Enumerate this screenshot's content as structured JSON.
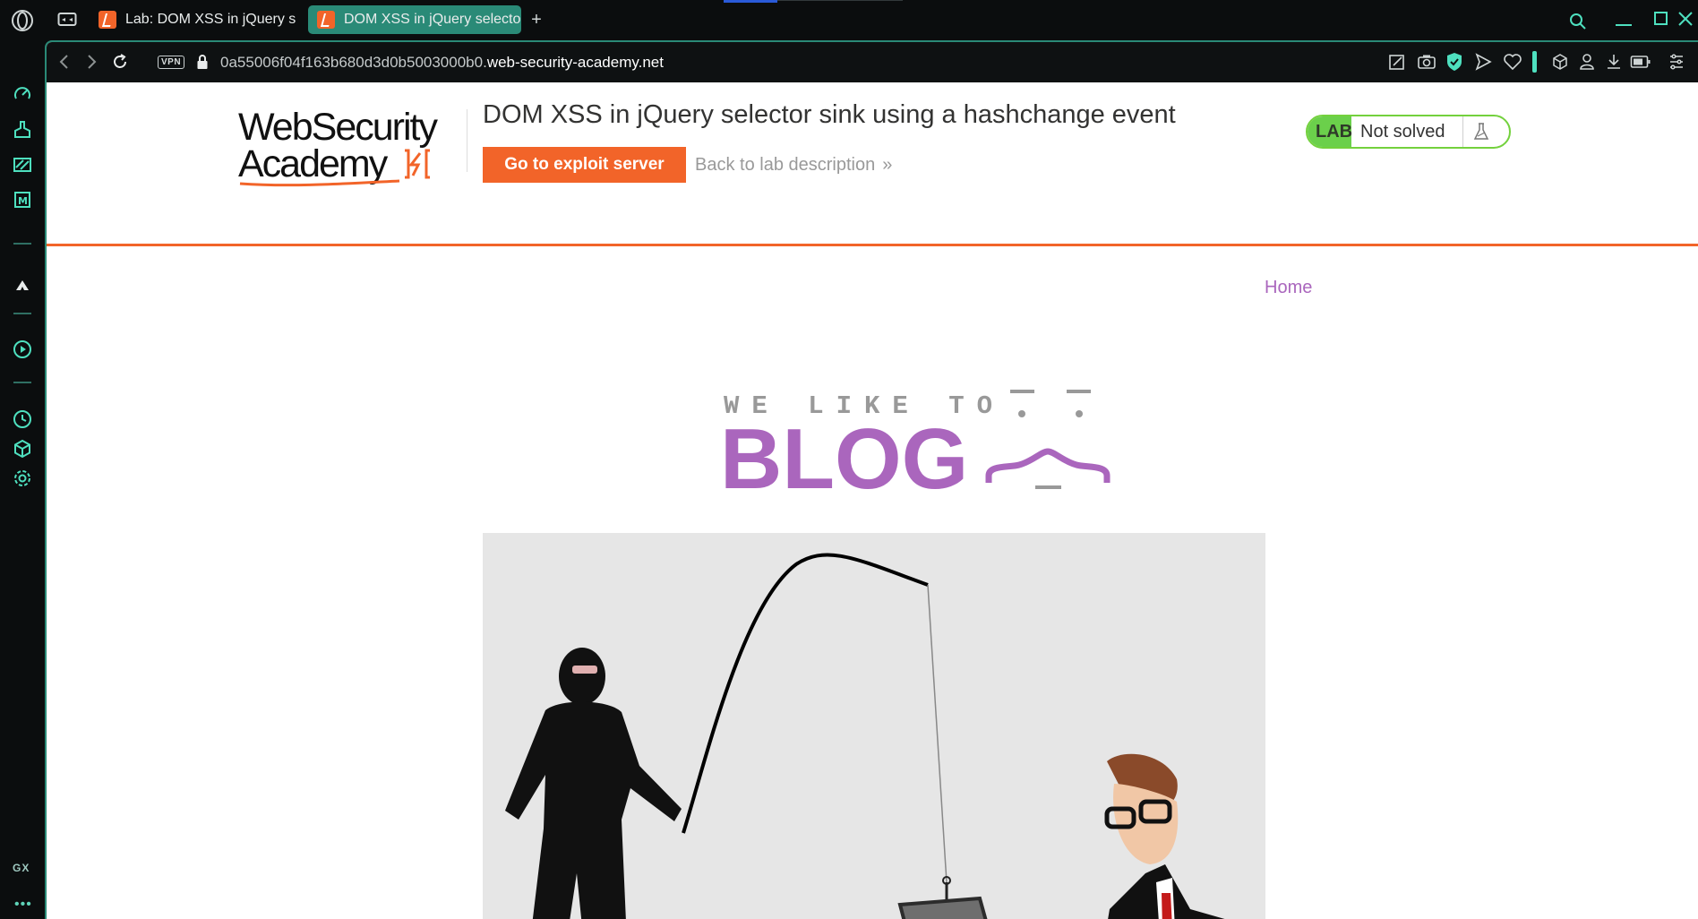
{
  "browser": {
    "tabs": [
      {
        "title": "Lab: DOM XSS in jQuery selector sink using a hashchange event",
        "active": false
      },
      {
        "title": "DOM XSS in jQuery selector sink using a hashchange event",
        "active": true
      }
    ],
    "new_tab_label": "+",
    "address": {
      "vpn_label": "VPN",
      "subdomain": "0a55006f04f163b680d3d0b5003000b0.",
      "domain": "web-security-academy.net"
    },
    "sidebar_label": "GX",
    "sidebar_more": "•••"
  },
  "page": {
    "logo": {
      "line1": "WebSecurity",
      "line2": "Academy"
    },
    "lab_title": "DOM XSS in jQuery selector sink using a hashchange event",
    "exploit_button": "Go to exploit server",
    "back_link": "Back to lab description",
    "back_chevron": "»",
    "lab_badge": "LAB",
    "lab_status": "Not solved",
    "nav": {
      "home": "Home"
    },
    "blog_header": {
      "top": "WE LIKE TO",
      "main": "BLOG"
    }
  },
  "colors": {
    "accent_orange": "#f26429",
    "blog_purple": "#aa66bd",
    "lab_green": "#6bd04b",
    "opera_teal": "#2a8a77"
  }
}
